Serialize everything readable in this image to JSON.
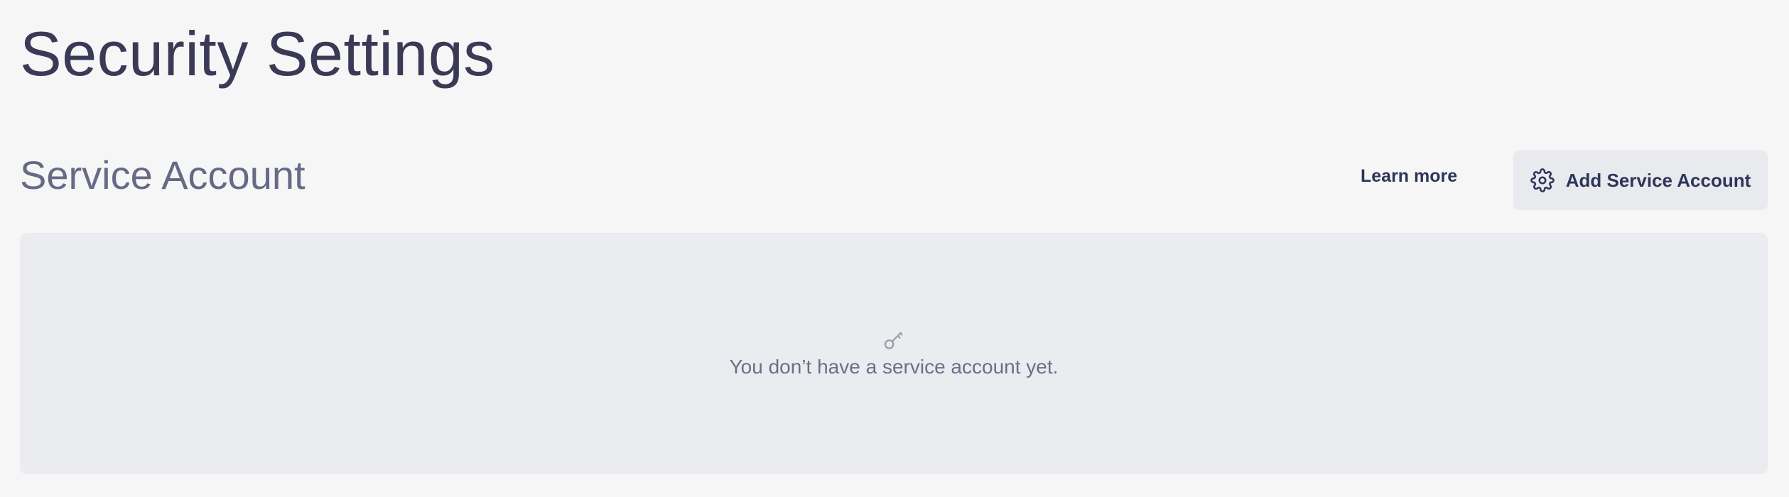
{
  "page": {
    "title": "Security Settings"
  },
  "service_account": {
    "section_title": "Service Account",
    "learn_more_label": "Learn more",
    "add_button_label": "Add Service Account",
    "add_button_icon": "gear-icon",
    "empty_state": {
      "icon": "key-icon",
      "message": "You don’t have a service account yet."
    }
  },
  "colors": {
    "background": "#f6f6f7",
    "title": "#3b3a56",
    "section_title": "#666a85",
    "button_bg": "#e9eaee",
    "button_text": "#2f355a",
    "panel_bg": "#ebecf0",
    "muted_text": "#6b6f87"
  }
}
